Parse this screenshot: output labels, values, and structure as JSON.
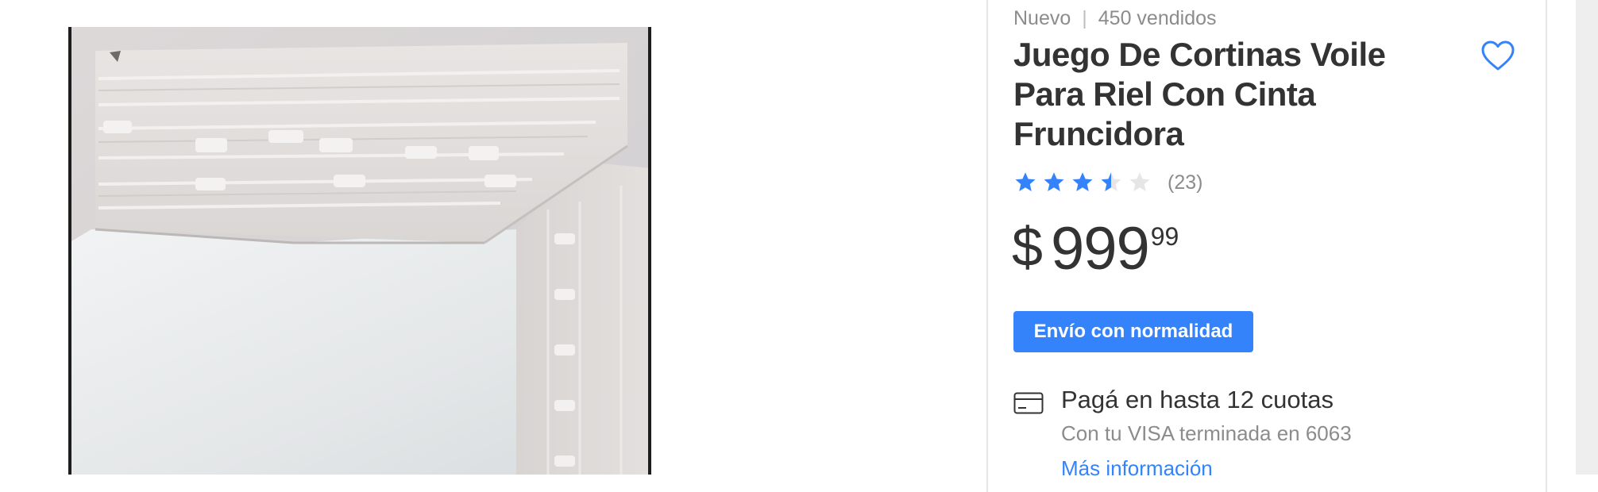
{
  "product": {
    "condition": "Nuevo",
    "separator": "|",
    "sold": "450 vendidos",
    "title": "Juego De Cortinas Voile Para Riel Con Cinta Fruncidora",
    "favorite_icon": "heart-outline-icon",
    "rating": {
      "value": 3.5,
      "max": 5,
      "reviews": "(23)",
      "color": "#3483fa",
      "empty_color": "#e6e6e6"
    },
    "price": {
      "symbol": "$",
      "integer": "999",
      "cents": "99"
    },
    "shipping_badge": "Envío con normalidad",
    "installments": {
      "icon": "credit-card-icon",
      "title": "Pagá en hasta 12 cuotas",
      "subtitle": "Con tu VISA terminada en 6063",
      "link": "Más información"
    }
  },
  "gallery": {
    "image": "curtain-fabric-photo"
  },
  "colors": {
    "accent": "#3483fa",
    "text_primary": "#333333",
    "text_secondary": "#8c8c8c"
  }
}
